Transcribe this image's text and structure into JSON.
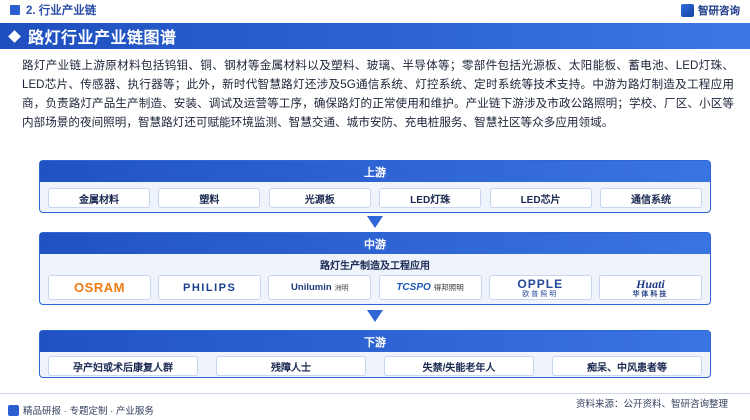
{
  "header": {
    "section_title": "2. 行业产业链",
    "brand_name": "智研咨询"
  },
  "banner": {
    "title": "路灯行业产业链图谱"
  },
  "paragraph": "路灯产业链上游原材料包括钨钼、铜、钢材等金属材料以及塑料、玻璃、半导体等；零部件包括光源板、太阳能板、蓄电池、LED灯珠、LED芯片、传感器、执行器等；此外，新时代智慧路灯还涉及5G通信系统、灯控系统、定时系统等技术支持。中游为路灯制造及工程应用商，负责路灯产品生产制造、安装、调试及运营等工序，确保路灯的正常使用和维护。产业链下游涉及市政公路照明；学校、厂区、小区等内部场景的夜间照明，智慧路灯还可赋能环境监测、智慧交通、城市安防、充电桩服务、智慧社区等众多应用领域。",
  "upstream": {
    "label": "上游",
    "items": [
      "金属材料",
      "塑料",
      "光源板",
      "LED灯珠",
      "LED芯片",
      "通信系统"
    ]
  },
  "midstream": {
    "label": "中游",
    "subtitle": "路灯生产制造及工程应用",
    "logos": {
      "osram": "OSRAM",
      "philips": "PHILIPS",
      "unilumin": "Unilumin",
      "unilumin_cn": "洲明",
      "tcspo": "TCSPO",
      "tcspo_cn": "得邦照明",
      "opple": "OPPLE",
      "opple_cn": "欧普照明",
      "huati": "Huati",
      "huati_cn": "华体科技"
    }
  },
  "downstream": {
    "label": "下游",
    "items": [
      "孕产妇或术后康复人群",
      "残障人士",
      "失禁/失能老年人",
      "痴呆、中风患者等"
    ]
  },
  "footer": {
    "left_text": "精品研报 · 专题定制 · 产业服务",
    "source": "资料来源：公开资料、智研咨询整理"
  },
  "colors": {
    "primary": "#2e66d6",
    "panel_bg": "#eef3fc",
    "osram": "#f07b10"
  }
}
